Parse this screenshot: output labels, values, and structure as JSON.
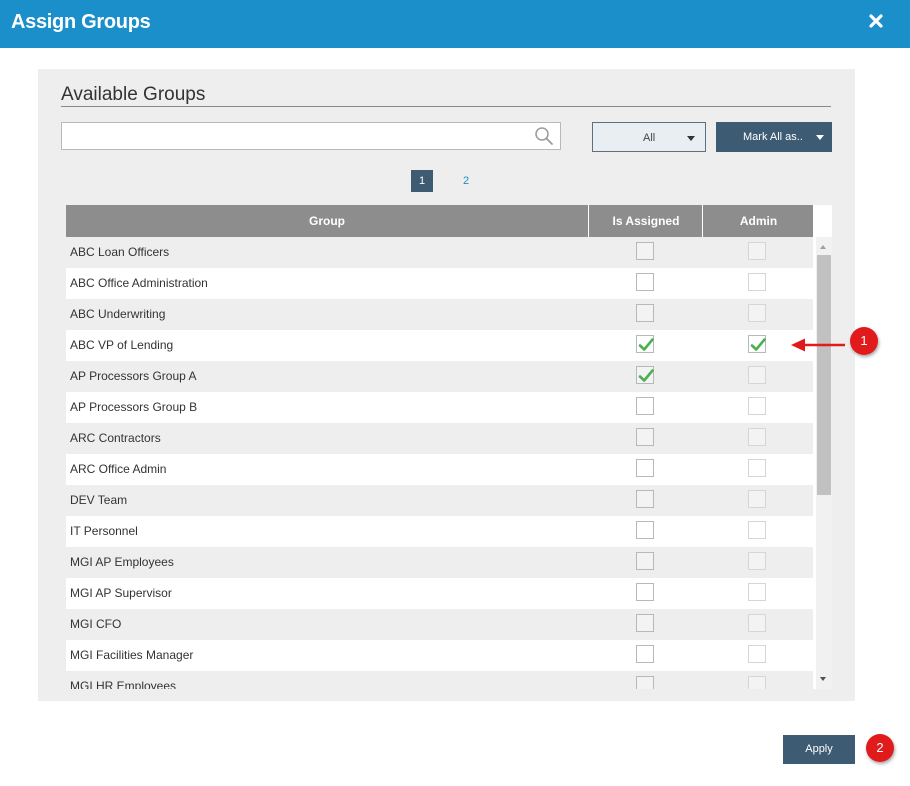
{
  "dialog": {
    "title": "Assign Groups",
    "close_icon": "close-icon"
  },
  "panel": {
    "section_title": "Available Groups",
    "search": {
      "value": "",
      "placeholder": ""
    },
    "filter": {
      "selected": "All"
    },
    "mark_all": {
      "label": "Mark All as.."
    },
    "pager": {
      "pages": [
        "1",
        "2"
      ],
      "current": "1"
    }
  },
  "table": {
    "headers": {
      "group": "Group",
      "is_assigned": "Is Assigned",
      "admin": "Admin"
    },
    "rows": [
      {
        "name": "ABC Loan Officers",
        "assigned": false,
        "admin": false
      },
      {
        "name": "ABC Office Administration",
        "assigned": false,
        "admin": false
      },
      {
        "name": "ABC Underwriting",
        "assigned": false,
        "admin": false
      },
      {
        "name": "ABC VP of Lending",
        "assigned": true,
        "admin": true
      },
      {
        "name": "AP Processors Group A",
        "assigned": true,
        "admin": false
      },
      {
        "name": "AP Processors Group B",
        "assigned": false,
        "admin": false
      },
      {
        "name": "ARC Contractors",
        "assigned": false,
        "admin": false
      },
      {
        "name": "ARC Office Admin",
        "assigned": false,
        "admin": false
      },
      {
        "name": "DEV Team",
        "assigned": false,
        "admin": false
      },
      {
        "name": "IT Personnel",
        "assigned": false,
        "admin": false
      },
      {
        "name": "MGI AP Employees",
        "assigned": false,
        "admin": false
      },
      {
        "name": "MGI AP Supervisor",
        "assigned": false,
        "admin": false
      },
      {
        "name": "MGI CFO",
        "assigned": false,
        "admin": false
      },
      {
        "name": "MGI Facilities Manager",
        "assigned": false,
        "admin": false
      },
      {
        "name": "MGI HR Employees",
        "assigned": false,
        "admin": false
      }
    ]
  },
  "annotations": {
    "marker1": "1",
    "marker2": "2"
  },
  "footer": {
    "apply_label": "Apply"
  },
  "colors": {
    "titlebar": "#1a8fca",
    "button": "#3d5b73",
    "check": "#4caf50",
    "marker": "#e11b1b"
  }
}
